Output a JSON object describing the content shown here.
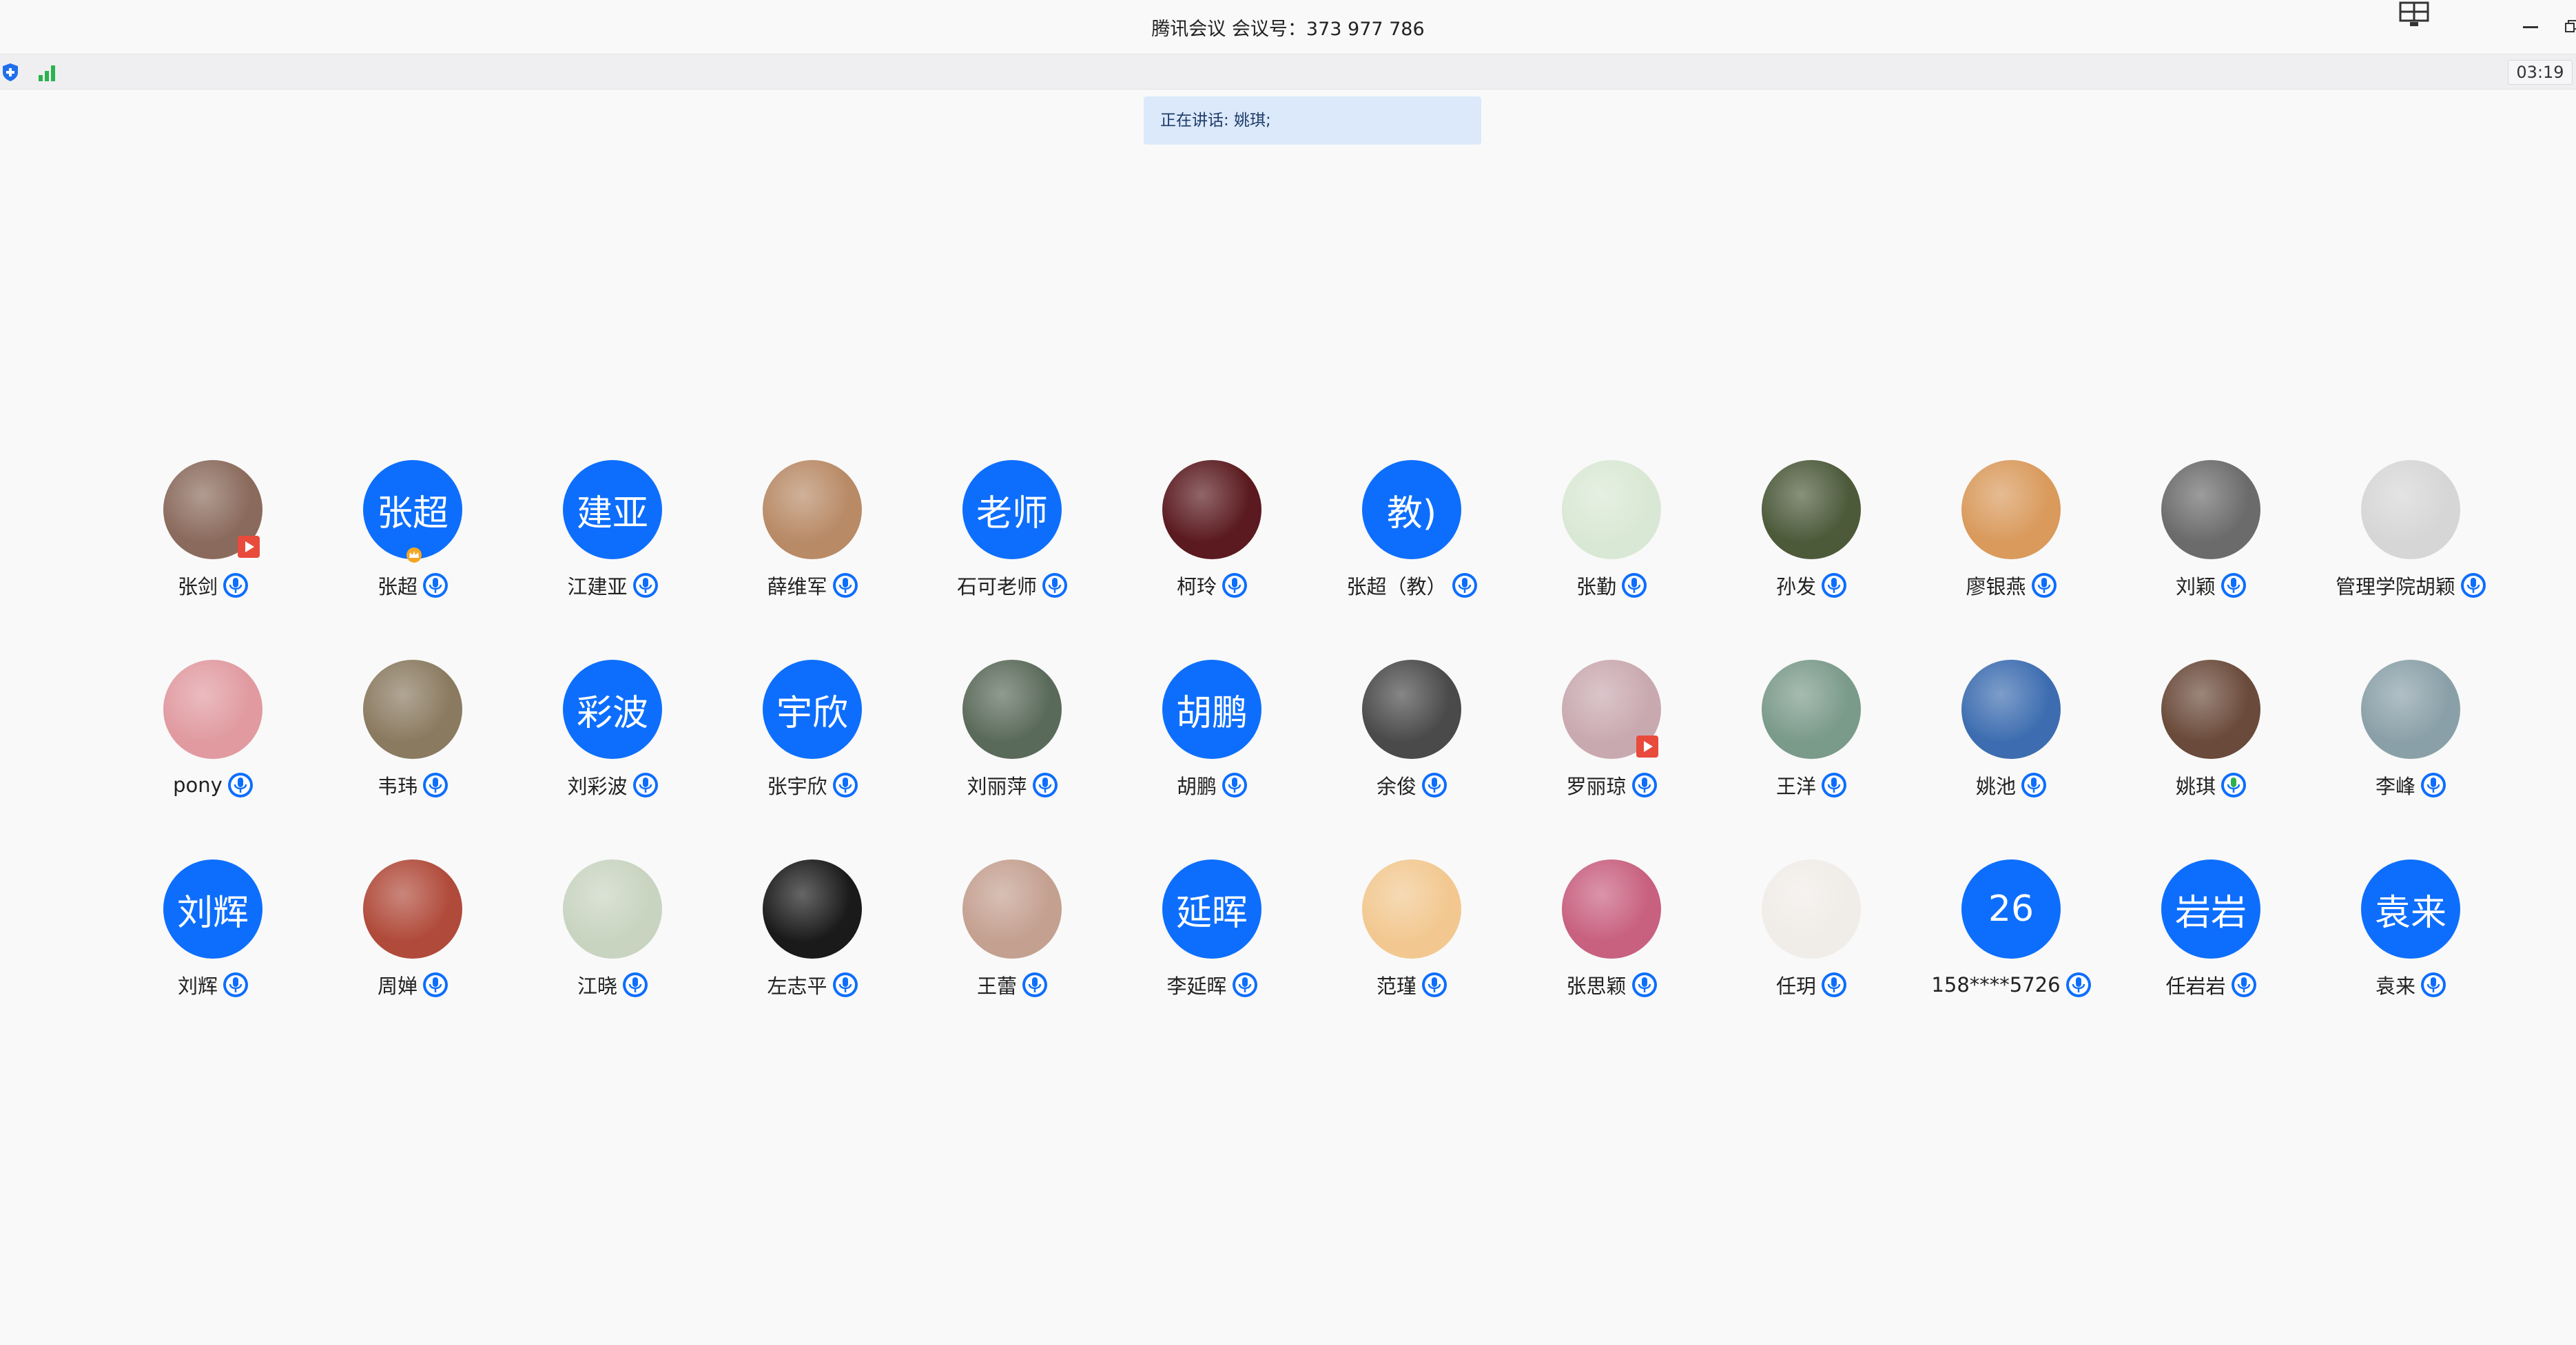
{
  "window": {
    "title": "腾讯会议 会议号：373 977 786"
  },
  "statusbar": {
    "timer": "03:19"
  },
  "speaking": {
    "label": "正在讲话: 姚琪;"
  },
  "participants": [
    [
      {
        "name": "张剑",
        "avatar_type": "photo",
        "avatar_color": "#8a6a5c",
        "badge": "screen-share-icon"
      },
      {
        "name": "张超",
        "avatar_type": "text",
        "avatar_text": "张超",
        "badge": "host-crown-icon"
      },
      {
        "name": "江建亚",
        "avatar_type": "text",
        "avatar_text": "建亚"
      },
      {
        "name": "薛维军",
        "avatar_type": "photo",
        "avatar_color": "#b88a66"
      },
      {
        "name": "石可老师",
        "avatar_type": "text",
        "avatar_text": "老师"
      },
      {
        "name": "柯玲",
        "avatar_type": "photo",
        "avatar_color": "#5a1a1f"
      },
      {
        "name": "张超（教）",
        "avatar_type": "text",
        "avatar_text": "教)"
      },
      {
        "name": "张勤",
        "avatar_type": "photo",
        "avatar_color": "#d9e8d4"
      },
      {
        "name": "孙发",
        "avatar_type": "photo",
        "avatar_color": "#4c5a3a"
      },
      {
        "name": "廖银燕",
        "avatar_type": "photo",
        "avatar_color": "#d99a5c"
      },
      {
        "name": "刘颖",
        "avatar_type": "photo",
        "avatar_color": "#6b6b6b"
      },
      {
        "name": "管理学院胡颖",
        "avatar_type": "photo",
        "avatar_color": "#d6d6d6"
      }
    ],
    [
      {
        "name": "pony",
        "avatar_type": "photo",
        "avatar_color": "#e09aa0"
      },
      {
        "name": "韦玮",
        "avatar_type": "photo",
        "avatar_color": "#8a7a60"
      },
      {
        "name": "刘彩波",
        "avatar_type": "text",
        "avatar_text": "彩波"
      },
      {
        "name": "张宇欣",
        "avatar_type": "text",
        "avatar_text": "宇欣"
      },
      {
        "name": "刘丽萍",
        "avatar_type": "photo",
        "avatar_color": "#5a6a5a"
      },
      {
        "name": "胡鹏",
        "avatar_type": "text",
        "avatar_text": "胡鹏"
      },
      {
        "name": "余俊",
        "avatar_type": "photo",
        "avatar_color": "#4a4a4a"
      },
      {
        "name": "罗丽琼",
        "avatar_type": "photo",
        "avatar_color": "#c9a9b0",
        "badge": "screen-share-icon"
      },
      {
        "name": "王洋",
        "avatar_type": "photo",
        "avatar_color": "#7a9a8a"
      },
      {
        "name": "姚池",
        "avatar_type": "photo",
        "avatar_color": "#3d6db0"
      },
      {
        "name": "姚琪",
        "avatar_type": "photo",
        "avatar_color": "#6a4a3a",
        "mic": "speaking"
      },
      {
        "name": "李峰",
        "avatar_type": "photo",
        "avatar_color": "#8aa0a8"
      }
    ],
    [
      {
        "name": "刘辉",
        "avatar_type": "text",
        "avatar_text": "刘辉"
      },
      {
        "name": "周婵",
        "avatar_type": "photo",
        "avatar_color": "#b04a3a"
      },
      {
        "name": "江晓",
        "avatar_type": "photo",
        "avatar_color": "#c8d4c0"
      },
      {
        "name": "左志平",
        "avatar_type": "photo",
        "avatar_color": "#1a1a1a"
      },
      {
        "name": "王蕾",
        "avatar_type": "photo",
        "avatar_color": "#c4a090"
      },
      {
        "name": "李延晖",
        "avatar_type": "text",
        "avatar_text": "延晖"
      },
      {
        "name": "范瑾",
        "avatar_type": "photo",
        "avatar_color": "#f2c890"
      },
      {
        "name": "张思颖",
        "avatar_type": "photo",
        "avatar_color": "#c86080"
      },
      {
        "name": "任玥",
        "avatar_type": "photo",
        "avatar_color": "#f0ece8"
      },
      {
        "name": "158****5726",
        "avatar_type": "text",
        "avatar_text": "26"
      },
      {
        "name": "任岩岩",
        "avatar_type": "text",
        "avatar_text": "岩岩"
      },
      {
        "name": "袁来",
        "avatar_type": "text",
        "avatar_text": "袁来"
      }
    ]
  ],
  "colors": {
    "accent": "#0d6efd",
    "speaking": "#2bb24c",
    "badge": "#e84a3c"
  }
}
